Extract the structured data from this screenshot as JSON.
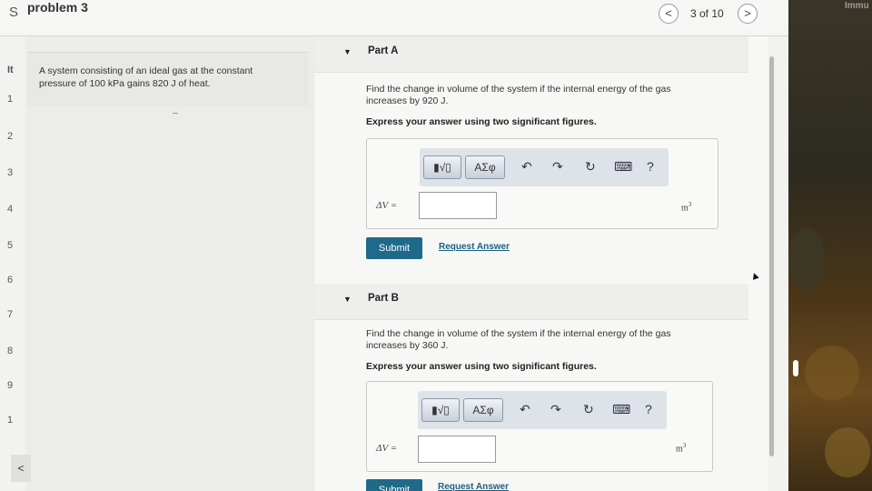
{
  "window": {
    "title": "problem 3",
    "left_edge_letter": "S",
    "counter": "3 of 10",
    "prev_symbol": "<",
    "next_symbol": ">",
    "overflow_label": "Immu"
  },
  "sidebar": {
    "numbers": [
      "It",
      "1",
      "2",
      "3",
      "4",
      "5",
      "6",
      "7",
      "8",
      "9",
      "1"
    ],
    "back_symbol": "<"
  },
  "problem": {
    "text_line1": "A system consisting of an ideal gas at the constant",
    "text_line2": "pressure of 100 kPa gains 820 J of heat."
  },
  "parts": [
    {
      "label": "Part A",
      "question_line1": "Find the change in volume of the system if the internal energy of the gas",
      "question_line2": "increases by 920 J.",
      "instruction": "Express your answer using two significant figures.",
      "variable": "ΔV =",
      "unit_base": "m",
      "unit_exp": "3",
      "answer_value": "",
      "submit_label": "Submit",
      "request_label": "Request Answer"
    },
    {
      "label": "Part B",
      "question_line1": "Find the change in volume of the system if the internal energy of the gas",
      "question_line2": "increases by 360 J.",
      "instruction": "Express your answer using two significant figures.",
      "variable": "ΔV =",
      "unit_base": "m",
      "unit_exp": "3",
      "answer_value": "",
      "submit_label": "Submit",
      "request_label": "Request Answer"
    }
  ],
  "toolbar": {
    "templates_label": "▮√▯",
    "greek_label": "ΑΣφ",
    "undo_icon": "↶",
    "redo_icon": "↷",
    "reset_icon": "↻",
    "keyboard_icon": "⌨",
    "help_icon": "?"
  },
  "colors": {
    "submit_bg": "#1f6a8a",
    "link": "#1d5f80",
    "toolbar_bg": "#dde3e9"
  }
}
